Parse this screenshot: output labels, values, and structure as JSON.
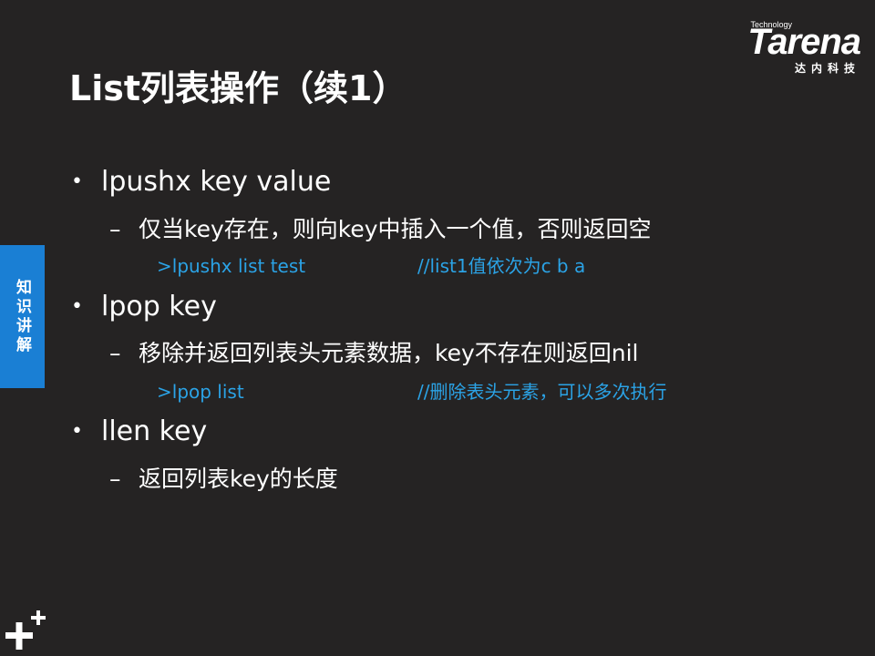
{
  "logo": {
    "tech_label": "Technology",
    "wordmark": "Tarena",
    "cn_label": "达内科技"
  },
  "title": "List列表操作（续1）",
  "side_tab": "知识讲解",
  "items": [
    {
      "bullet": "•",
      "heading": "lpushx key value",
      "dash": "–",
      "desc": "仅当key存在，则向key中插入一个值，否则返回空",
      "code": ">lpushx list test",
      "comment": "//list1值依次为c b a"
    },
    {
      "bullet": "•",
      "heading": "lpop key",
      "dash": "–",
      "desc": "移除并返回列表头元素数据，key不存在则返回nil",
      "code": ">lpop list",
      "comment": "//删除表头元素，可以多次执行"
    },
    {
      "bullet": "•",
      "heading": "llen key",
      "dash": "–",
      "desc": "返回列表key的长度"
    }
  ],
  "colors": {
    "background": "#252323",
    "accent_blue": "#1a7fd4",
    "code_blue": "#2ba3e6",
    "text": "#ffffff"
  },
  "icons": {
    "corner": "plus-mark-icon"
  }
}
